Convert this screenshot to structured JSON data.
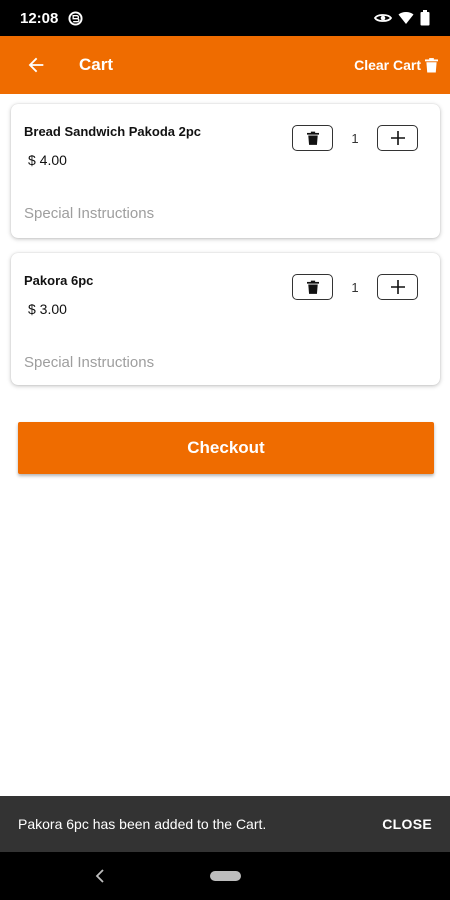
{
  "status_bar": {
    "time": "12:08",
    "icons": [
      "notification-badge-icon",
      "data-saver-icon",
      "wifi-icon",
      "battery-icon"
    ]
  },
  "app_bar": {
    "title": "Cart",
    "back_icon": "arrow-back-icon",
    "clear_cart_label": "Clear Cart",
    "clear_cart_icon": "trash-icon",
    "background_color": "#ef6c00"
  },
  "cart": {
    "items": [
      {
        "name": "Bread Sandwich Pakoda 2pc",
        "price": "$ 4.00",
        "quantity": "1",
        "instructions_placeholder": "Special Instructions"
      },
      {
        "name": "Pakora 6pc",
        "price": "$ 3.00",
        "quantity": "1",
        "instructions_placeholder": "Special Instructions"
      }
    ]
  },
  "checkout": {
    "label": "Checkout"
  },
  "snackbar": {
    "message": "Pakora 6pc has been added to the Cart.",
    "action": "CLOSE"
  },
  "nav_bar": {
    "icons": [
      "nav-back-icon",
      "nav-home-pill"
    ]
  }
}
